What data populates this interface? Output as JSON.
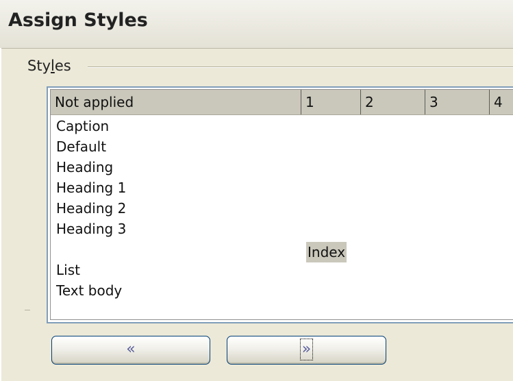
{
  "dialog": {
    "title": "Assign Styles"
  },
  "group": {
    "label_prefix": "Sty",
    "label_mnemonic": "l",
    "label_suffix": "es"
  },
  "table": {
    "columns": [
      "Not applied",
      "1",
      "2",
      "3",
      "4"
    ],
    "unassigned_rows": [
      "Caption",
      "Default",
      "Heading",
      "Heading 1",
      "Heading 2",
      "Heading 3"
    ],
    "selected_item": {
      "label": "Index",
      "column": "1"
    },
    "more_rows": [
      "List",
      "Text body"
    ]
  },
  "buttons": {
    "move_left": "«",
    "move_right": "»"
  },
  "colors": {
    "accent": "#7f9db9",
    "selection": "#cac8bb",
    "header": "#cac8bb"
  },
  "icons": {
    "move_left": "double-chevron-left-icon",
    "move_right": "double-chevron-right-icon"
  }
}
